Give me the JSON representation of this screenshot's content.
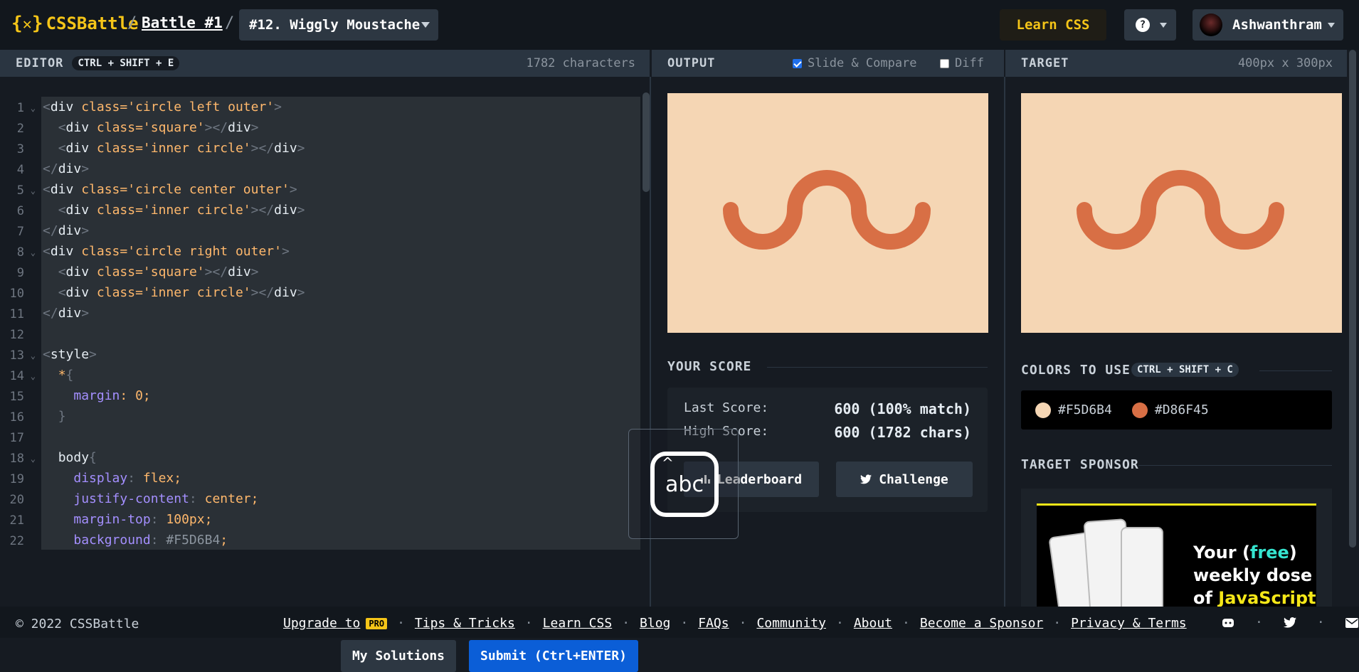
{
  "header": {
    "logo_text": "CSSBattle",
    "battle_link": "Battle #1",
    "target_select": "#12. Wiggly Moustache",
    "learn_label": "Learn CSS",
    "help_label": "?",
    "username": "Ashwanthram"
  },
  "editor": {
    "title": "EDITOR",
    "shortcut": "CTRL + SHIFT + E",
    "char_count": "1782 characters",
    "line_numbers": [
      "1",
      "2",
      "3",
      "4",
      "5",
      "6",
      "7",
      "8",
      "9",
      "10",
      "11",
      "12",
      "13",
      "14",
      "15",
      "16",
      "17",
      "18",
      "19",
      "20",
      "21",
      "22"
    ],
    "my_solutions_label": "My Solutions",
    "submit_label": "Submit (Ctrl+ENTER)"
  },
  "output": {
    "title": "OUTPUT",
    "slide_compare_label": "Slide & Compare",
    "slide_compare_checked": true,
    "diff_label": "Diff",
    "diff_checked": false
  },
  "target": {
    "title": "TARGET",
    "dimensions": "400px x 300px"
  },
  "score": {
    "title": "YOUR SCORE",
    "last_label": "Last Score:",
    "last_value": "600 (100% match)",
    "high_label": "High Score:",
    "high_value": "600 (1782 chars)",
    "leaderboard_label": "Leaderboard",
    "challenge_label": "Challenge"
  },
  "overlay": {
    "icon_text": "abc"
  },
  "colors": {
    "title": "COLORS TO USE",
    "shortcut": "CTRL + SHIFT + C",
    "items": [
      {
        "hex": "#F5D6B4",
        "color": "#F5D6B4"
      },
      {
        "hex": "#D86F45",
        "color": "#D86F45"
      }
    ]
  },
  "sponsor": {
    "title": "TARGET SPONSOR",
    "line1_a": "Your (",
    "line1_hl": "free",
    "line1_b": ")",
    "line2": "weekly dose",
    "line3_a": "of ",
    "line3_hl": "JavaScript"
  },
  "footer": {
    "copyright": "© 2022 CSSBattle",
    "upgrade": "Upgrade to",
    "pro_badge": "PRO",
    "tips": "Tips & Tricks",
    "learn": "Learn CSS",
    "blog": "Blog",
    "faqs": "FAQs",
    "community": "Community",
    "about": "About",
    "sponsor": "Become a Sponsor",
    "privacy": "Privacy & Terms",
    "separator": "·"
  },
  "theme": {
    "accent_yellow": "#f5c518",
    "submit_blue": "#0b5ed7",
    "canvas_bg": "#F5D6B4",
    "shape_color": "#D86F45"
  }
}
